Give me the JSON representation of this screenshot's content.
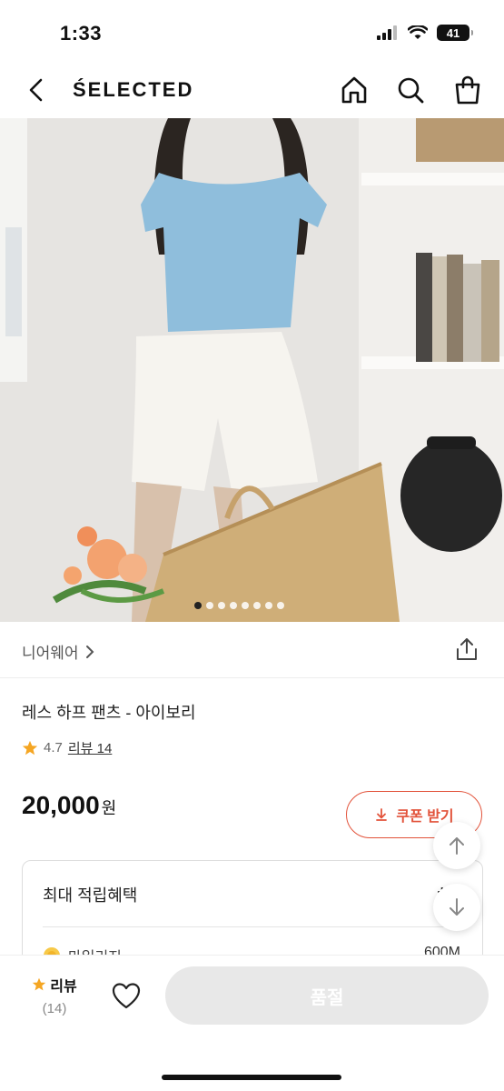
{
  "status_bar": {
    "time": "1:33",
    "battery": "41"
  },
  "nav": {
    "brand": "ŚELECTED"
  },
  "hero": {
    "dots_total": 8,
    "active_dot": 0
  },
  "category": {
    "label": "니어웨어"
  },
  "product": {
    "name": "레스 하프 팬츠 - 아이보리",
    "rating": "4.7",
    "review_link": "리뷰 14"
  },
  "price": {
    "amount": "20,000",
    "currency": "원"
  },
  "coupon": {
    "label": "쿠폰 받기"
  },
  "benefit": {
    "title": "최대 적립혜택",
    "value": "+ 6",
    "mileage_label": "마일리지",
    "mileage_amount": "600M"
  },
  "bottom": {
    "review_label": "리뷰",
    "review_count": "(14)",
    "soldout_label": "품절"
  },
  "colors": {
    "accent": "#e2523a",
    "star": "#f5a623",
    "shirt": "#8fbedc"
  }
}
